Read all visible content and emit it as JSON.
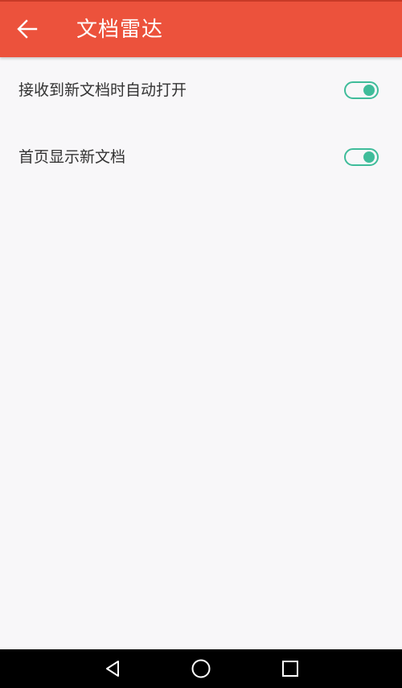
{
  "app_bar": {
    "title": "文档雷达",
    "back_icon": "arrow-left-icon",
    "background_color": "#ec523c"
  },
  "settings": [
    {
      "label": "接收到新文档时自动打开",
      "enabled": true
    },
    {
      "label": "首页显示新文档",
      "enabled": true
    }
  ],
  "toggle_color": "#3fbc9a",
  "nav_bar": {
    "back_icon": "triangle-back-icon",
    "home_icon": "circle-home-icon",
    "recents_icon": "square-recents-icon"
  }
}
